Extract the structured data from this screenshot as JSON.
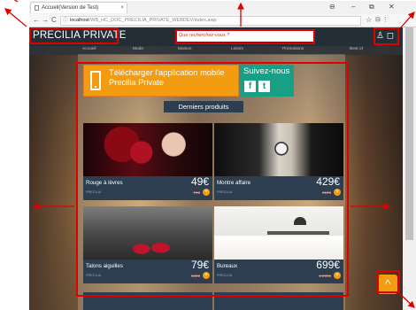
{
  "browser": {
    "tab_title": "Accueil(Version de Test)",
    "tab_close": "×",
    "window_controls": [
      "⊖",
      "–",
      "⧉",
      "✕"
    ],
    "nav": {
      "back": "←",
      "forward": "→",
      "reload": "C"
    },
    "url_host": "localhost",
    "url_path": "/WB_HC_DOC_PRECILIA_PRIVATE_WEBDEV/index.awp",
    "url_prefix": "ⓘ ",
    "star": "☆",
    "menu_icons": "⊟ ⋮"
  },
  "site": {
    "brand": "PRECILIA PRIVATE",
    "search_placeholder": "Que recherchez-vous ?",
    "menu": [
      "Accueil",
      "Mode",
      "Maison",
      "Loisirs",
      "Promotions",
      "Best of"
    ],
    "app_banner": "Télécharger l'application mobile Precilia Private",
    "social_title": "Suivez-nous",
    "social_icons": {
      "facebook": "f",
      "twitter": "t"
    },
    "section_title": "Derniers produits",
    "products": [
      {
        "name": "Rouge à lèvres",
        "price": "49€",
        "brand": "PRECILIA",
        "old_price": "74€"
      },
      {
        "name": "Montre affaire",
        "price": "429€",
        "brand": "PRECILIA",
        "old_price": "619€"
      },
      {
        "name": "Talons aiguilles",
        "price": "79€",
        "brand": "PRECILIA",
        "old_price": "149€"
      },
      {
        "name": "Bureaux",
        "price": "699€",
        "brand": "PRECILIA",
        "old_price": "1 299€"
      }
    ],
    "plus": "+",
    "to_top": "^",
    "user_icons": "♙ ◻"
  },
  "colors": {
    "header": "#232e36",
    "card": "#2c3e50",
    "orange": "#f39c12",
    "green": "#16a085",
    "annotation": "#e00000"
  }
}
